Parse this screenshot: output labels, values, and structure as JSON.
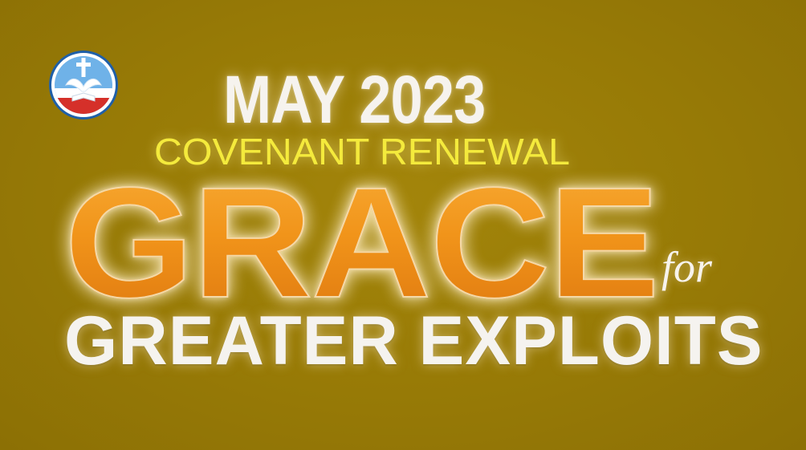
{
  "logo": {
    "icon": "church-emblem-icon",
    "colors": {
      "ring": "#1f5fa8",
      "sky": "#6fb2e8",
      "band": "#d5302a",
      "dove": "#ffffff"
    }
  },
  "headline": {
    "month_year": "MAY 2023",
    "subtitle": "COVENANT RENEWAL",
    "theme_main": "GRACE",
    "theme_connector": "for",
    "theme_tail": "GREATER EXPLOITS"
  },
  "colors": {
    "background": "#9a7d07",
    "month_year": "#f6f3ee",
    "subtitle": "#f4ea3c",
    "theme_main": "#f39a1d",
    "theme_tail": "#f5f3ef"
  }
}
